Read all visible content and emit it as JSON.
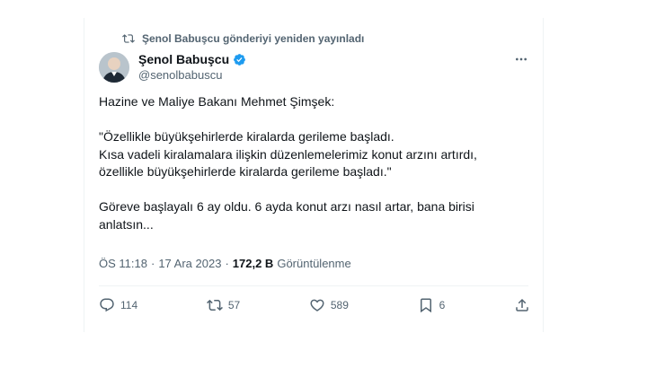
{
  "retweet_banner": {
    "text": "Şenol Babuşcu gönderiyi yeniden yayınladı",
    "icon": "retweet-icon"
  },
  "author": {
    "name": "Şenol Babuşcu",
    "handle": "@senolbabuscu",
    "verified_icon": "verified-badge-icon",
    "verified_color": "#1d9bf0"
  },
  "tweet": {
    "line1": "Hazine ve Maliye Bakanı Mehmet Şimşek:",
    "line2": "\"Özellikle büyükşehirlerde kiralarda gerileme başladı.",
    "line3": "Kısa vadeli kiralamalara ilişkin düzenlemelerimiz konut arzını artırdı,",
    "line4": "özellikle büyükşehirlerde kiralarda gerileme başladı.\"",
    "line5": "Göreve başlayalı 6 ay oldu. 6 ayda konut arzı nasıl artar, bana birisi",
    "line6": "anlatsın..."
  },
  "meta": {
    "time": "ÖS 11:18",
    "separator": "·",
    "date": "17 Ara 2023",
    "views_count": "172,2 B",
    "views_label": "Görüntülenme"
  },
  "actions": {
    "reply": {
      "icon": "reply-icon",
      "count": "114"
    },
    "retweet": {
      "icon": "retweet-icon",
      "count": "57"
    },
    "like": {
      "icon": "heart-icon",
      "count": "589"
    },
    "bookmark": {
      "icon": "bookmark-icon",
      "count": "6"
    },
    "share": {
      "icon": "share-icon"
    }
  },
  "colors": {
    "text": "#0f1419",
    "secondary": "#536471",
    "accent": "#1d9bf0",
    "divider": "#eff3f4"
  }
}
